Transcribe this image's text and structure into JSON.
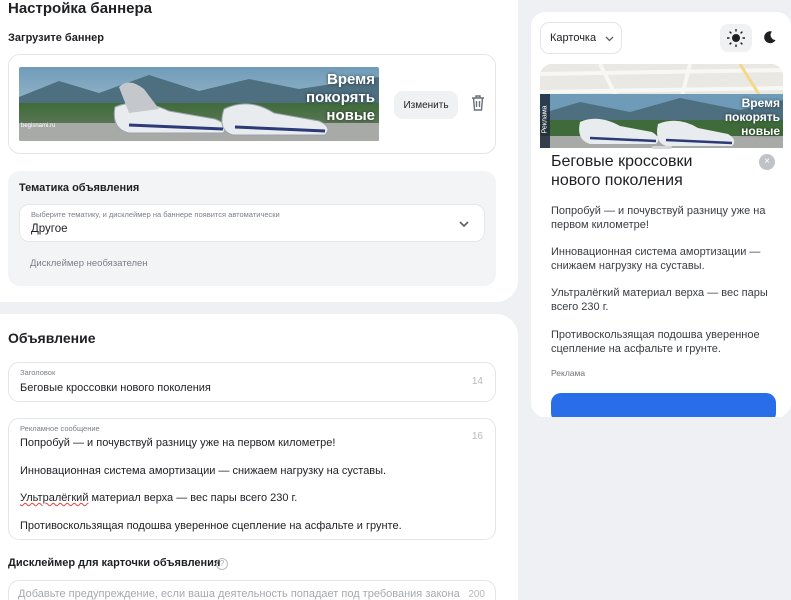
{
  "banner_settings": {
    "title": "Настройка баннера",
    "upload_label": "Загрузите баннер",
    "banner_text": [
      "Время",
      "покорять",
      "новые"
    ],
    "banner_site": "begisnami.ru",
    "change_label": "Изменить"
  },
  "topic": {
    "title": "Тематика объявления",
    "hint": "Выберите тематику, и дисклеймер на баннере появится автоматически",
    "value": "Другое",
    "disclaimer_note": "Дисклеймер необязателен"
  },
  "ad": {
    "section_title": "Объявление",
    "headline_label": "Заголовок",
    "headline_value": "Беговые кроссовки нового поколения",
    "headline_count": "14",
    "message_label": "Рекламное сообщение",
    "message_count": "16",
    "message_lines": [
      "Попробуй — и почувствуй разницу уже на первом километре!",
      "Инновационная система амортизации — снижаем нагрузку на суставы.",
      "Ультралёгкий",
      " материал верха — вес пары всего 230 г.",
      "Противоскользящая подошва уверенное сцепление на асфальте и грунте."
    ]
  },
  "card_disclaimer": {
    "title": "Дисклеймер для карточки объявления",
    "help": "?",
    "placeholder": "Добавьте предупреждение, если ваша деятельность попадает под требования закона",
    "count": "200"
  },
  "preview": {
    "view_value": "Карточка",
    "banner_text": [
      "Время",
      "покорять",
      "новые"
    ],
    "banner_tag": "Реклама",
    "title": "Беговые кроссовки нового поколения",
    "paragraphs": [
      "Попробуй — и почувствуй разницу уже на первом километре!",
      "Инновационная система амортизации — снижаем нагрузку на суставы.",
      "Ультралёгкий материал верха — вес пары всего 230 г.",
      "Противоскользящая подошва уверенное сцепление на асфальте и грунте."
    ],
    "ad_label": "Реклама",
    "close": "×"
  },
  "colors": {
    "accent": "#2a6de8",
    "page_bg": "#eef0f3",
    "error_underline": "#e0443e"
  }
}
